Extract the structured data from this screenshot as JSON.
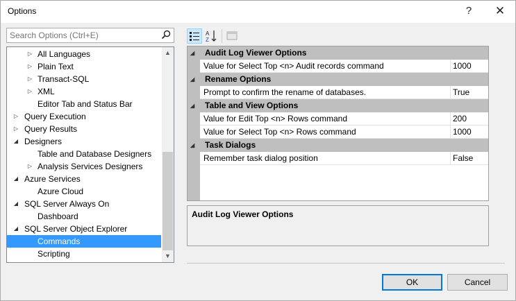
{
  "window": {
    "title": "Options",
    "help_label": "?",
    "close_label": "✕"
  },
  "search": {
    "placeholder": "Search Options (Ctrl+E)"
  },
  "tree": {
    "items": [
      {
        "label": "All Languages",
        "arrow": "▷"
      },
      {
        "label": "Plain Text",
        "arrow": "▷"
      },
      {
        "label": "Transact-SQL",
        "arrow": "▷"
      },
      {
        "label": "XML",
        "arrow": "▷"
      },
      {
        "label": "Editor Tab and Status Bar",
        "arrow": ""
      },
      {
        "label": "Query Execution",
        "arrow": "▷"
      },
      {
        "label": "Query Results",
        "arrow": "▷"
      },
      {
        "label": "Designers",
        "arrow": "◢"
      },
      {
        "label": "Table and Database Designers",
        "arrow": ""
      },
      {
        "label": "Analysis Services Designers",
        "arrow": "▷"
      },
      {
        "label": "Azure Services",
        "arrow": "◢"
      },
      {
        "label": "Azure Cloud",
        "arrow": ""
      },
      {
        "label": "SQL Server Always On",
        "arrow": "◢"
      },
      {
        "label": "Dashboard",
        "arrow": ""
      },
      {
        "label": "SQL Server Object Explorer",
        "arrow": "◢"
      },
      {
        "label": "Commands",
        "arrow": ""
      },
      {
        "label": "Scripting",
        "arrow": ""
      }
    ],
    "selected": "Commands"
  },
  "grid": {
    "categories": [
      {
        "name": "Audit Log Viewer Options",
        "props": [
          {
            "name": "Value for Select Top <n> Audit records command",
            "value": "1000"
          }
        ]
      },
      {
        "name": "Rename Options",
        "props": [
          {
            "name": "Prompt to confirm the rename of databases.",
            "value": "True"
          }
        ]
      },
      {
        "name": "Table and View Options",
        "props": [
          {
            "name": "Value for Edit Top <n> Rows command",
            "value": "200"
          },
          {
            "name": "Value for Select Top <n> Rows command",
            "value": "1000"
          }
        ]
      },
      {
        "name": "Task Dialogs",
        "props": [
          {
            "name": "Remember task dialog position",
            "value": "False"
          }
        ]
      }
    ]
  },
  "description": {
    "title": "Audit Log Viewer Options"
  },
  "buttons": {
    "ok": "OK",
    "cancel": "Cancel"
  },
  "colors": {
    "selection": "#3399ff",
    "category_bg": "#bfbfbf",
    "ok_border": "#0078d7"
  }
}
